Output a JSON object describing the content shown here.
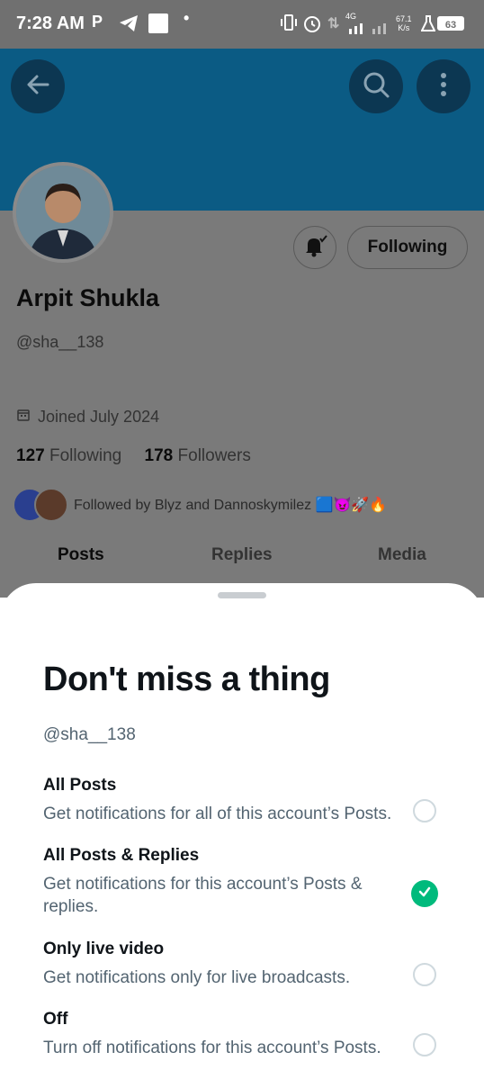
{
  "status_bar": {
    "time": "7:28 AM",
    "network_speed_value": "67.1",
    "network_speed_unit": "K/s",
    "signal": "4G",
    "battery": "63"
  },
  "header": {
    "back_icon": "arrow-left-icon",
    "search_icon": "search-icon",
    "more_icon": "more-vertical-icon",
    "banner_color": "#0b5b84"
  },
  "profile": {
    "name": "Arpit Shukla",
    "handle": "@sha__138",
    "joined": "Joined July 2024",
    "following_count": "127",
    "following_label": "Following",
    "followers_count": "178",
    "followers_label": "Followers",
    "followed_by": "Followed by Blyz and Dannoskymilez 🟦😈🚀🔥",
    "follow_button": "Following"
  },
  "tabs": [
    {
      "label": "Posts"
    },
    {
      "label": "Replies"
    },
    {
      "label": "Media"
    }
  ],
  "sheet": {
    "title": "Don't miss a thing",
    "handle": "@sha__138",
    "options": [
      {
        "title": "All Posts",
        "desc": "Get notifications for all of this account’s Posts.",
        "selected": false
      },
      {
        "title": "All Posts & Replies",
        "desc": "Get notifications for this account’s Posts & replies.",
        "selected": true
      },
      {
        "title": "Only live video",
        "desc": "Get notifications only for live broadcasts.",
        "selected": false
      },
      {
        "title": "Off",
        "desc": "Turn off notifications for this account’s Posts.",
        "selected": false
      }
    ],
    "accent_color": "#00ba7c"
  }
}
